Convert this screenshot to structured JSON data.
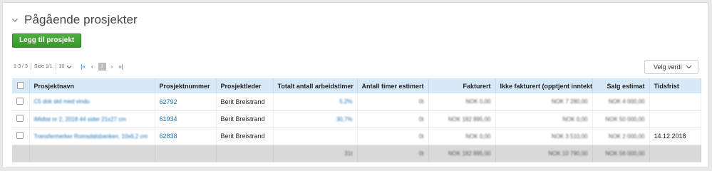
{
  "section": {
    "title": "Pågående prosjekter"
  },
  "toolbar": {
    "add_label": "Legg til prosjekt"
  },
  "pager": {
    "range": "1-3 / 3",
    "page": "Side 1/1",
    "per_page": "10",
    "current": "1",
    "first": "|«",
    "prev": "‹",
    "next": "›",
    "last": "»|"
  },
  "filter": {
    "label": "Velg verdi"
  },
  "table": {
    "headers": [
      "Prosjektnavn",
      "Prosjektnummer",
      "Prosjektleder",
      "Totalt antall arbeidstimer",
      "Antall timer estimert",
      "Fakturert",
      "Ikke fakturert (opptjent inntekt)",
      "Salg estimat",
      "Tidsfrist"
    ],
    "rows": [
      {
        "name": "C5 dok skil med vindu",
        "number": "62792",
        "leader": "Berit Breistrand",
        "hours": "5,2%",
        "est": "0t",
        "invoiced": "NOK 0,00",
        "not_invoiced": "NOK 7 280,00",
        "sales": "NOK 4 000,00",
        "deadline": ""
      },
      {
        "name": "iMidtat nr 2, 2018 44 sider 21x27 cm",
        "number": "61934",
        "leader": "Berit Breistrand",
        "hours": "30,7%",
        "est": "0t",
        "invoiced": "NOK 182 895,00",
        "not_invoiced": "NOK 0,00",
        "sales": "NOK 50 000,00",
        "deadline": ""
      },
      {
        "name": "Transfermerker Romsdalsbanken, 10x6,2 cm",
        "number": "62838",
        "leader": "Berit Breistrand",
        "hours": "",
        "est": "0t",
        "invoiced": "NOK 0,00",
        "not_invoiced": "NOK 3 510,00",
        "sales": "NOK 2 000,00",
        "deadline": "14.12.2018"
      }
    ],
    "totals": {
      "hours": "31t",
      "est": "0t",
      "invoiced": "NOK 182 895,00",
      "not_invoiced": "NOK 10 790,00",
      "sales": "NOK 56 000,00"
    }
  }
}
